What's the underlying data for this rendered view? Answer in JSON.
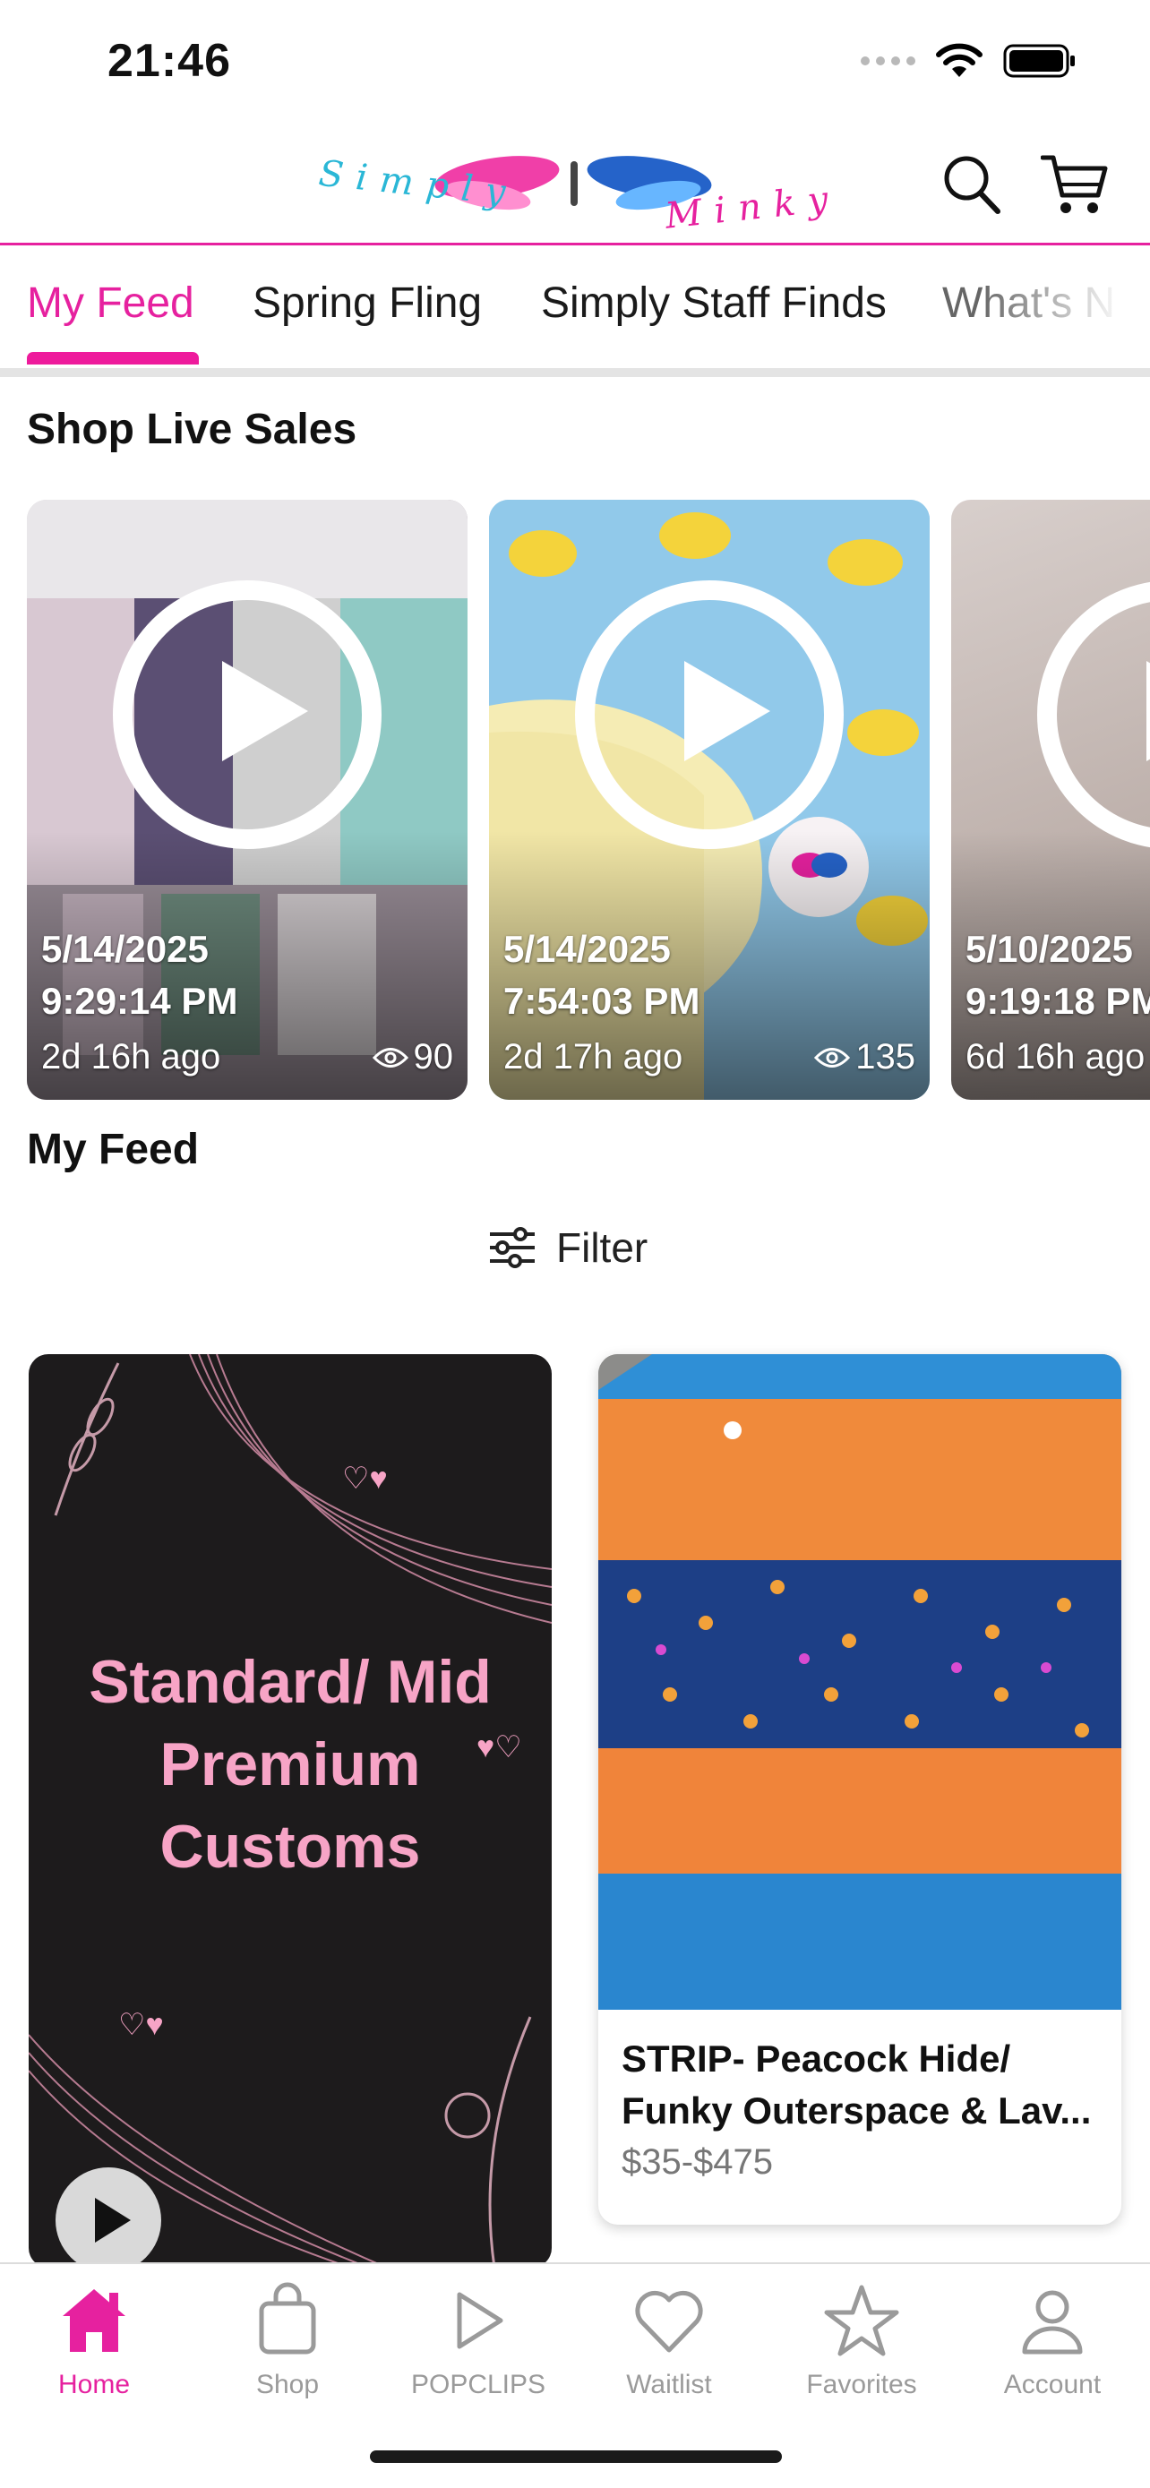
{
  "status_bar": {
    "time": "21:46"
  },
  "header": {
    "logo_text": "Simply Minky",
    "search_icon": "search-icon",
    "cart_icon": "cart-icon"
  },
  "tabs": [
    {
      "label": "My Feed",
      "active": true
    },
    {
      "label": "Spring Fling",
      "active": false
    },
    {
      "label": "Simply Staff Finds",
      "active": false
    },
    {
      "label": "What's N",
      "active": false
    }
  ],
  "live_sales": {
    "title": "Shop Live Sales",
    "cards": [
      {
        "date": "5/14/2025",
        "time": "9:29:14 PM",
        "ago": "2d 16h ago",
        "views": "90"
      },
      {
        "date": "5/14/2025",
        "time": "7:54:03 PM",
        "ago": "2d 17h ago",
        "views": "135"
      },
      {
        "date": "5/10/2025",
        "time": "9:19:18 PM",
        "ago": "6d 16h ago",
        "views": ""
      }
    ]
  },
  "feed": {
    "title": "My Feed",
    "filter_label": "Filter",
    "promo": {
      "line1": "Standard/ Mid",
      "line2": "Premium",
      "line3": "Customs"
    },
    "product": {
      "title": "STRIP- Peacock Hide/ Funky Outerspace & Lav...",
      "price": "$35-$475"
    }
  },
  "bottom_nav": [
    {
      "label": "Home",
      "icon": "home-icon",
      "active": true
    },
    {
      "label": "Shop",
      "icon": "shopping-bag-icon",
      "active": false
    },
    {
      "label": "POPCLIPS",
      "icon": "play-icon",
      "active": false
    },
    {
      "label": "Waitlist",
      "icon": "heart-icon",
      "active": false
    },
    {
      "label": "Favorites",
      "icon": "star-icon",
      "active": false
    },
    {
      "label": "Account",
      "icon": "person-icon",
      "active": false
    }
  ],
  "colors": {
    "accent": "#e6219f",
    "inactive": "#9a9a9a"
  }
}
